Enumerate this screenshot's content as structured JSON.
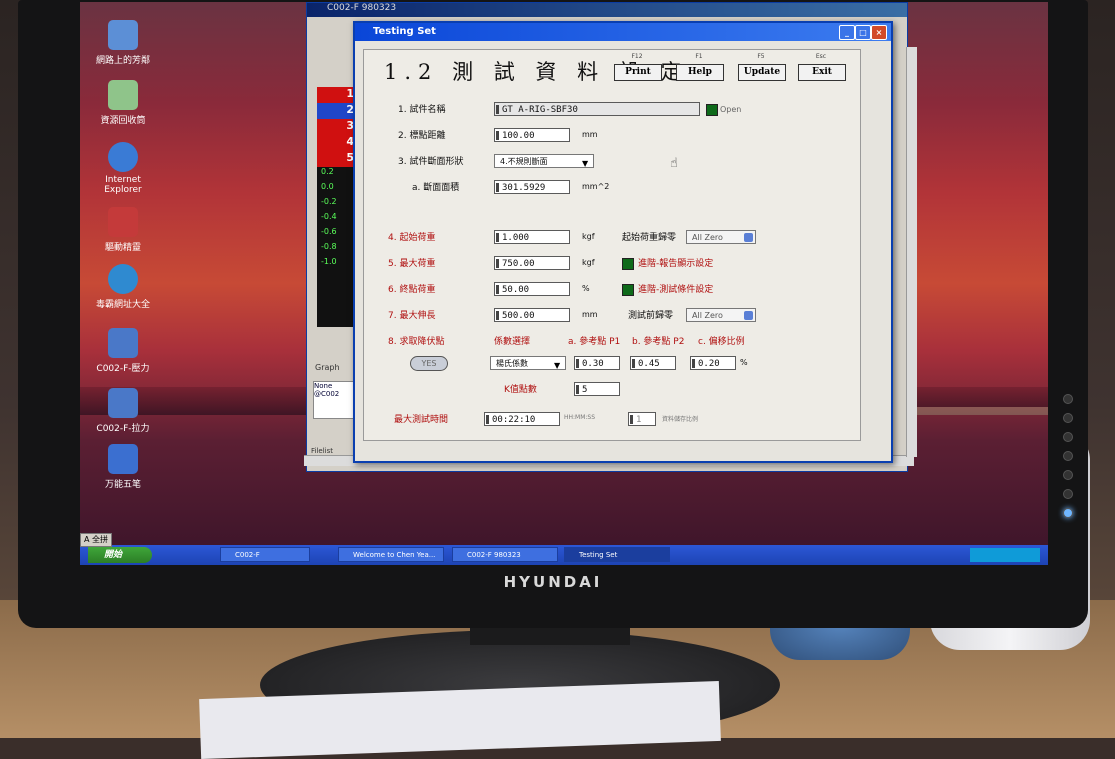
{
  "desktop": {
    "icons": [
      "網路上的芳鄰",
      "資源回收筒",
      "Internet Explorer",
      "驅動精靈",
      "毒霸網址大全",
      "C002-F-壓力",
      "C002-F-拉力",
      "万能五笔"
    ]
  },
  "back_window": {
    "title": "C002-F 980323",
    "side_numbers": [
      "1",
      "2",
      "3",
      "4",
      "5"
    ],
    "side_values": [
      "0.2",
      "0.0",
      "-0.2",
      "-0.4",
      "-0.6",
      "-0.8",
      "-1.0"
    ],
    "graph_label": "Graph",
    "none_label": "None",
    "path_label": "@C002",
    "filelist_label": "Filelist"
  },
  "window": {
    "title": "Testing Set",
    "heading": "1.2 測 試 資 料 設 定",
    "buttons": [
      {
        "key": "F12",
        "label": "Print"
      },
      {
        "key": "F1",
        "label": "Help"
      },
      {
        "key": "F5",
        "label": "Update"
      },
      {
        "key": "Esc",
        "label": "Exit"
      }
    ]
  },
  "form": {
    "specimen_name_label": "1. 試件名稱",
    "specimen_name_value": "GT A-RIG-SBF30",
    "open_label": "Open",
    "gauge_length_label": "2. 標點距離",
    "gauge_length_value": "100.00",
    "gauge_length_unit": "mm",
    "section_shape_label": "3. 試件斷面形狀",
    "section_shape_value": "4.不規則斷面",
    "area_label": "a. 斷面面積",
    "area_value": "301.5929",
    "area_unit": "mm^2",
    "init_load_label": "4. 起始荷重",
    "init_load_value": "1.000",
    "init_load_unit": "kgf",
    "init_zero_label": "起始荷重歸零",
    "init_zero_value": "All Zero",
    "max_load_label": "5. 最大荷重",
    "max_load_value": "750.00",
    "max_load_unit": "kgf",
    "report_setting_label": "進階-報告顯示設定",
    "end_load_label": "6. 終點荷重",
    "end_load_value": "50.00",
    "end_load_unit": "%",
    "test_condition_label": "進階-測試條件設定",
    "max_elong_label": "7. 最大伸長",
    "max_elong_value": "500.00",
    "max_elong_unit": "mm",
    "pre_zero_label": "測試前歸零",
    "pre_zero_value": "All Zero",
    "yield_label": "8. 求取降伏點",
    "yes_label": "YES",
    "coef_label": "係數選擇",
    "coef_value": "楊氏係數",
    "ref_p1_label": "a. 參考點 P1",
    "ref_p1_value": "0.30",
    "ref_p2_label": "b. 參考點 P2",
    "ref_p2_value": "0.45",
    "offset_label": "c. 偏移比例",
    "offset_value": "0.20",
    "offset_unit": "%",
    "k_label": "K值點數",
    "k_value": "5",
    "max_time_label": "最大測試時間",
    "max_time_value": "00:22:10",
    "max_time_unit": "HH:MM:SS",
    "save_ratio_value": "1",
    "save_ratio_label": "資料儲存比例"
  },
  "taskbar": {
    "start_label": "開始",
    "ime_label": "A 全拼",
    "items": [
      "C002-F",
      "Welcome to Chen Yea...",
      "C002-F 980323",
      "Testing Set"
    ]
  },
  "monitor": {
    "brand": "HYUNDAI"
  }
}
